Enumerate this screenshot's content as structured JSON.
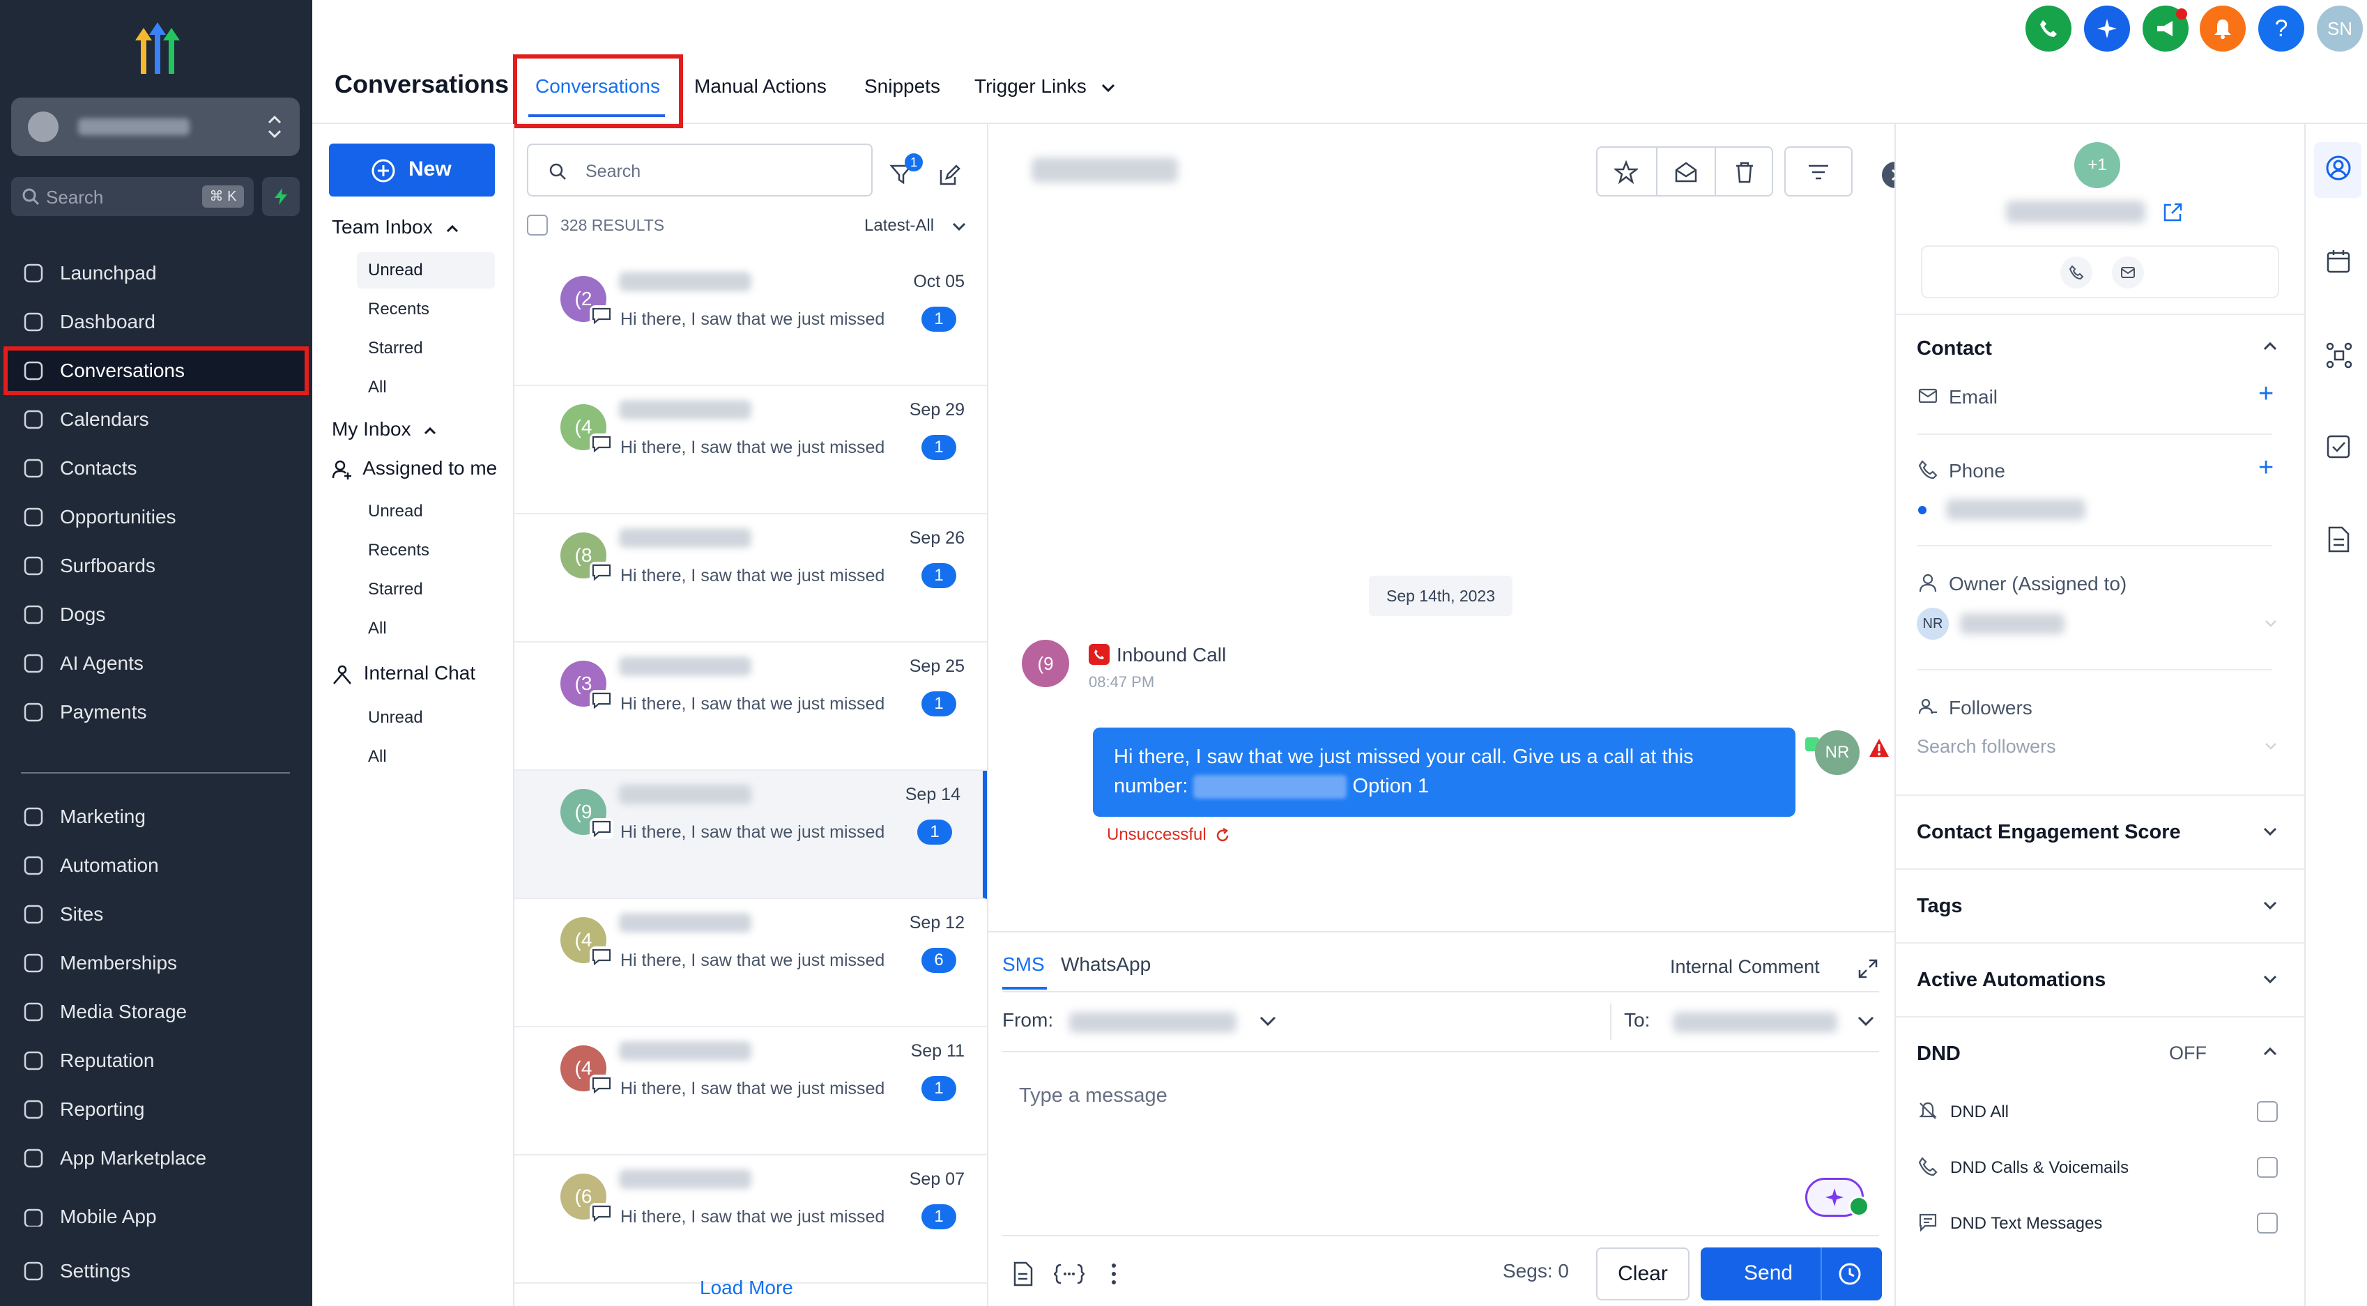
{
  "colors": {
    "sidebar_bg": "#1f2937",
    "accent": "#1463e8",
    "highlight_box": "#e11d1d",
    "unread_badge": "#1570ef",
    "error": "#d92d20"
  },
  "sidebar": {
    "search_label": "Search",
    "search_shortcut": "⌘ K",
    "items": [
      {
        "label": "Launchpad",
        "icon": "rocket-icon"
      },
      {
        "label": "Dashboard",
        "icon": "dashboard-grid-icon"
      },
      {
        "label": "Conversations",
        "icon": "chat-bubble-icon",
        "active": true
      },
      {
        "label": "Calendars",
        "icon": "calendar-icon"
      },
      {
        "label": "Contacts",
        "icon": "contacts-icon"
      },
      {
        "label": "Opportunities",
        "icon": "opportunities-icon"
      },
      {
        "label": "Surfboards",
        "icon": "surfboard-icon"
      },
      {
        "label": "Dogs",
        "icon": "dog-icon"
      },
      {
        "label": "AI Agents",
        "icon": "sparkle-icon"
      },
      {
        "label": "Payments",
        "icon": "receipt-icon"
      },
      {
        "label": "Marketing",
        "icon": "send-icon"
      },
      {
        "label": "Automation",
        "icon": "automation-icon"
      },
      {
        "label": "Sites",
        "icon": "sites-icon"
      },
      {
        "label": "Memberships",
        "icon": "award-icon"
      },
      {
        "label": "Media Storage",
        "icon": "image-icon"
      },
      {
        "label": "Reputation",
        "icon": "star-icon"
      },
      {
        "label": "Reporting",
        "icon": "trend-icon"
      },
      {
        "label": "App Marketplace",
        "icon": "apps-grid-icon"
      },
      {
        "label": "Mobile App",
        "icon": "phone-icon"
      },
      {
        "label": "Settings",
        "icon": "gear-icon"
      }
    ]
  },
  "header": {
    "title": "Conversations",
    "tabs": [
      {
        "label": "Conversations",
        "active": true
      },
      {
        "label": "Manual Actions"
      },
      {
        "label": "Snippets"
      },
      {
        "label": "Trigger Links"
      }
    ],
    "user_initials": "SN",
    "help_label": "?"
  },
  "filters": {
    "new_label": "New",
    "team_inbox": "Team Inbox",
    "team_items": [
      "Unread",
      "Recents",
      "Starred",
      "All"
    ],
    "my_inbox": "My Inbox",
    "assigned_to_me": "Assigned to me",
    "my_items": [
      "Unread",
      "Recents",
      "Starred",
      "All"
    ],
    "internal_chat": "Internal Chat",
    "chat_items": [
      "Unread",
      "All"
    ]
  },
  "list": {
    "search_placeholder": "Search",
    "filter_count": "1",
    "results": "328 RESULTS",
    "sort": "Latest-All",
    "load_more": "Load More",
    "rows": [
      {
        "initial": "(2",
        "color": "#9b6fc7",
        "preview": "Hi there, I saw that we just missed your call",
        "date": "Oct 05",
        "count": "1"
      },
      {
        "initial": "(4",
        "color": "#8bbf7a",
        "preview": "Hi there, I saw that we just missed your call",
        "date": "Sep 29",
        "count": "1"
      },
      {
        "initial": "(8",
        "color": "#93b87a",
        "preview": "Hi there, I saw that we just missed your call",
        "date": "Sep 26",
        "count": "1"
      },
      {
        "initial": "(3",
        "color": "#a46cc2",
        "preview": "Hi there, I saw that we just missed your call",
        "date": "Sep 25",
        "count": "1"
      },
      {
        "initial": "(9",
        "color": "#7bb8a0",
        "preview": "Hi there, I saw that we just missed your call",
        "date": "Sep 14",
        "count": "1",
        "selected": true
      },
      {
        "initial": "(4",
        "color": "#b9b878",
        "preview": "Hi there, I saw that we just missed your call",
        "date": "Sep 12",
        "count": "6"
      },
      {
        "initial": "(4",
        "color": "#c4655e",
        "preview": "Hi there, I saw that we just missed your call",
        "date": "Sep 11",
        "count": "1"
      },
      {
        "initial": "(6",
        "color": "#c0b87e",
        "preview": "Hi there, I saw that we just missed your call",
        "date": "Sep 07",
        "count": "1"
      }
    ]
  },
  "chat": {
    "date_divider": "Sep 14th, 2023",
    "caller_initial": "(9",
    "call_title": "Inbound Call",
    "call_time": "08:47 PM",
    "message_line1": "Hi there, I saw that we just missed your call. Give us a call at this",
    "message_prefix": "number:",
    "message_suffix": "Option 1",
    "agent_initials": "NR",
    "status": "Unsuccessful",
    "channels": {
      "sms": "SMS",
      "whatsapp": "WhatsApp",
      "internal": "Internal Comment"
    },
    "from_label": "From:",
    "to_label": "To:",
    "message_placeholder": "Type a message",
    "segs": "Segs: 0",
    "clear": "Clear",
    "send": "Send"
  },
  "contact": {
    "avatar": "+1",
    "section_contact": "Contact",
    "email_label": "Email",
    "phone_label": "Phone",
    "owner_label": "Owner (Assigned to)",
    "owner_initials": "NR",
    "followers_label": "Followers",
    "followers_placeholder": "Search followers",
    "engagement": "Contact Engagement Score",
    "tags": "Tags",
    "automations": "Active Automations",
    "dnd": "DND",
    "dnd_state": "OFF",
    "dnd_items": [
      "DND All",
      "DND Calls & Voicemails",
      "DND Text Messages"
    ]
  }
}
